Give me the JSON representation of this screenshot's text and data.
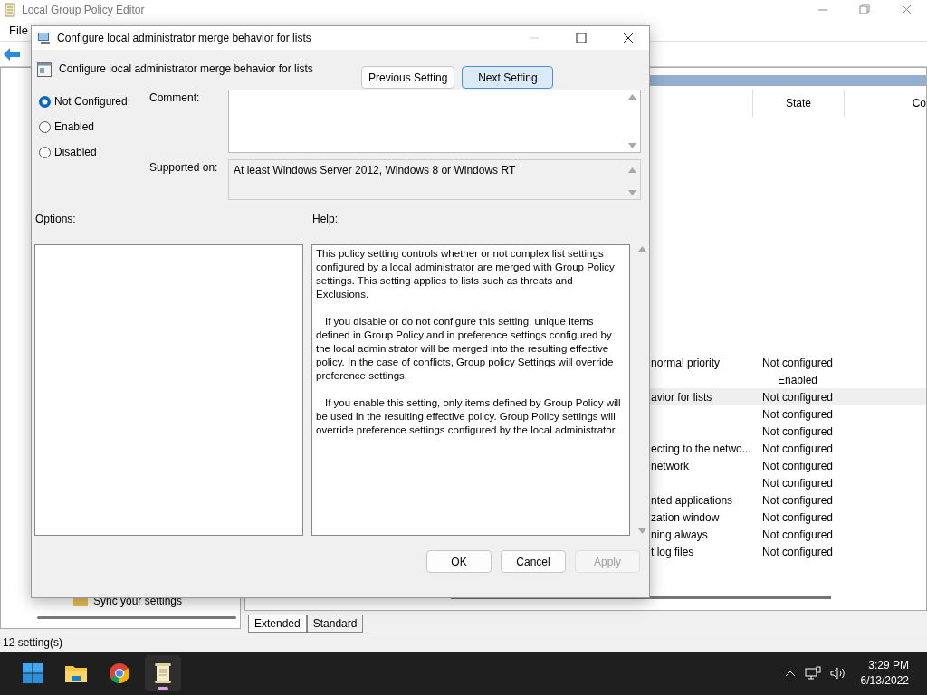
{
  "window": {
    "title": "Local Group Policy Editor"
  },
  "menu": [
    "File"
  ],
  "tree": {
    "items": [
      {
        "label": "Sync your settings"
      }
    ]
  },
  "list": {
    "columns": [
      "State",
      "Co"
    ],
    "rows": [
      {
        "name": "normal priority",
        "state": "Not configured",
        "selected": false
      },
      {
        "name": "",
        "state": "Enabled",
        "selected": false
      },
      {
        "name": "avior for lists",
        "state": "Not configured",
        "selected": true
      },
      {
        "name": "",
        "state": "Not configured",
        "selected": false
      },
      {
        "name": "",
        "state": "Not configured",
        "selected": false
      },
      {
        "name": "ecting to the netwo...",
        "state": "Not configured",
        "selected": false
      },
      {
        "name": "network",
        "state": "Not configured",
        "selected": false
      },
      {
        "name": "",
        "state": "Not configured",
        "selected": false
      },
      {
        "name": "nted applications",
        "state": "Not configured",
        "selected": false
      },
      {
        "name": "zation window",
        "state": "Not configured",
        "selected": false
      },
      {
        "name": "ning always",
        "state": "Not configured",
        "selected": false
      },
      {
        "name": "t log files",
        "state": "Not configured",
        "selected": false
      }
    ]
  },
  "tabs": [
    {
      "label": "Extended",
      "selected": true
    },
    {
      "label": "Standard",
      "selected": false
    }
  ],
  "status_bar": "12 setting(s)",
  "dialog": {
    "title": "Configure local administrator merge behavior for lists",
    "heading": "Configure local administrator merge behavior for lists",
    "nav_buttons": [
      {
        "label": "Previous Setting",
        "hovered": false
      },
      {
        "label": "Next Setting",
        "hovered": true
      }
    ],
    "radios": [
      {
        "label": "Not Configured",
        "selected": true
      },
      {
        "label": "Enabled",
        "selected": false
      },
      {
        "label": "Disabled",
        "selected": false
      }
    ],
    "comment_label": "Comment:",
    "supported_label": "Supported on:",
    "supported_value": "At least Windows Server 2012, Windows 8 or Windows RT",
    "options_label": "Options:",
    "help_label": "Help:",
    "help": [
      "This policy setting controls whether or not complex list settings configured by a local administrator are merged with Group Policy settings. This setting applies to lists such as threats and Exclusions.",
      "If you disable or do not configure this setting, unique items defined in Group Policy and in preference settings configured by the local administrator will be merged into the resulting effective policy. In the case of conflicts, Group policy Settings will override preference settings.",
      "If you enable this setting, only items defined by Group Policy will be used in the resulting effective policy. Group Policy settings will override preference settings configured by the local administrator."
    ],
    "buttons": [
      {
        "label": "OK",
        "disabled": false
      },
      {
        "label": "Cancel",
        "disabled": false
      },
      {
        "label": "Apply",
        "disabled": true
      }
    ]
  },
  "taskbar": {
    "apps": [
      {
        "kind": "start",
        "active": false
      },
      {
        "kind": "folder",
        "active": false
      },
      {
        "kind": "browser",
        "active": false
      },
      {
        "kind": "notepad",
        "active": true
      }
    ],
    "time": "3:29 PM",
    "date": "6/13/2022"
  }
}
